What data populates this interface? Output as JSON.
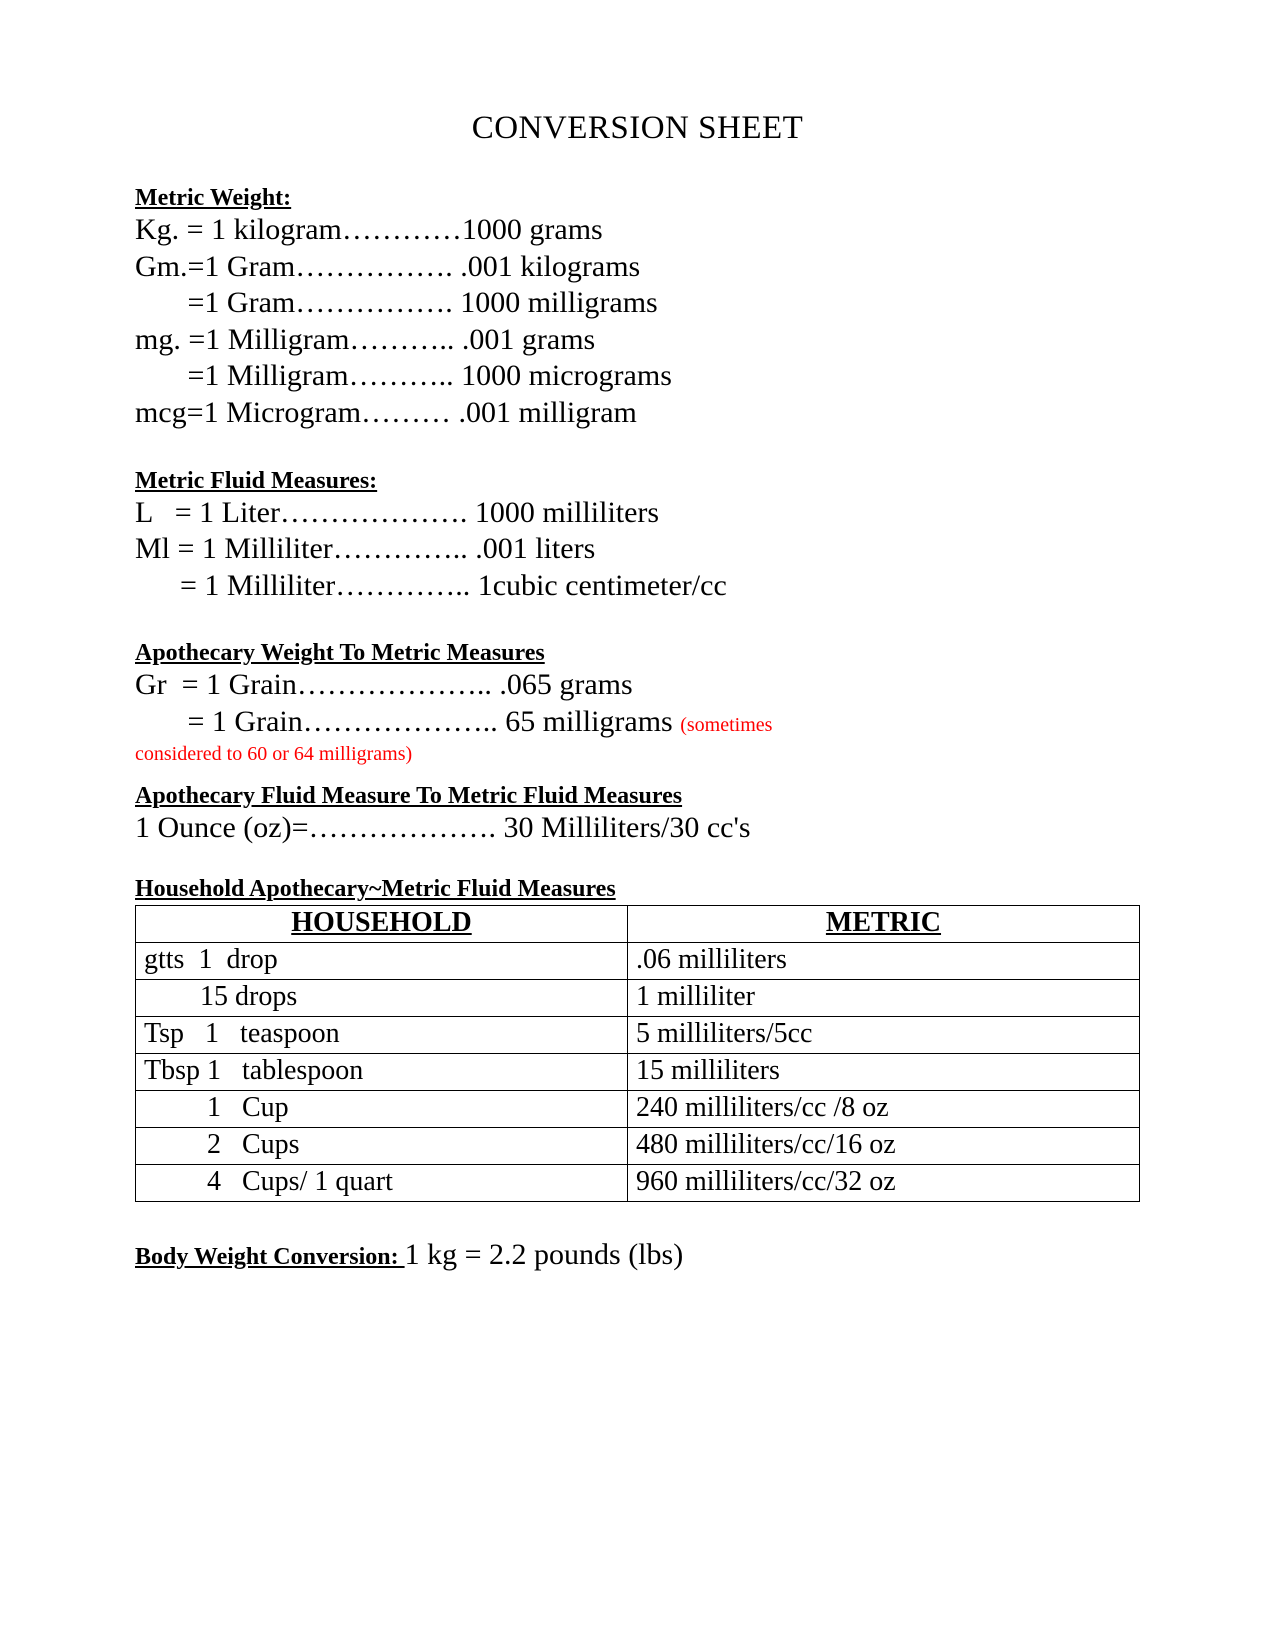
{
  "title": "CONVERSION SHEET",
  "metric_weight": {
    "heading": "Metric Weight:",
    "lines": [
      "Kg. = 1 kilogram…………1000 grams",
      "Gm.=1 Gram……………. .001 kilograms",
      "       =1 Gram……………. 1000 milligrams",
      "mg. =1 Milligram……….. .001 grams",
      "       =1 Milligram……….. 1000 micrograms",
      "mcg=1 Microgram……… .001 milligram"
    ]
  },
  "metric_fluid": {
    "heading": "Metric Fluid Measures:",
    "lines": [
      "L   = 1 Liter………………. 1000 milliliters",
      "Ml = 1 Milliliter………….. .001 liters",
      "      = 1 Milliliter………….. 1cubic centimeter/cc"
    ]
  },
  "apoth_weight": {
    "heading": "Apothecary Weight To Metric Measures",
    "line1": "Gr  = 1 Grain……………….. .065 grams",
    "line2_main": "       = 1 Grain……………….. 65 milligrams ",
    "line2_note_a": "(sometimes",
    "line2_note_b": "considered to 60 or 64 milligrams)"
  },
  "apoth_fluid": {
    "heading": "Apothecary Fluid Measure To Metric Fluid Measures",
    "line": "1 Ounce (oz)=………………. 30 Milliliters/30 cc's"
  },
  "household": {
    "heading": "Household Apothecary~Metric Fluid Measures",
    "col1": "HOUSEHOLD",
    "col2": "METRIC",
    "rows": [
      {
        "h": "gtts  1  drop",
        "m": ".06 milliliters"
      },
      {
        "h": "        15 drops",
        "m": "1 milliliter"
      },
      {
        "h": "Tsp   1   teaspoon",
        "m": "5 milliliters/5cc"
      },
      {
        "h": "Tbsp 1   tablespoon",
        "m": "15 milliliters"
      },
      {
        "h": "         1   Cup",
        "m": "240 milliliters/cc /8 oz"
      },
      {
        "h": "         2   Cups",
        "m": "480 milliliters/cc/16 oz"
      },
      {
        "h": "         4   Cups/ 1 quart",
        "m": "960 milliliters/cc/32 oz"
      }
    ]
  },
  "body_weight": {
    "label": "Body Weight Conversion:   ",
    "value": "1 kg = 2.2 pounds (lbs)"
  }
}
